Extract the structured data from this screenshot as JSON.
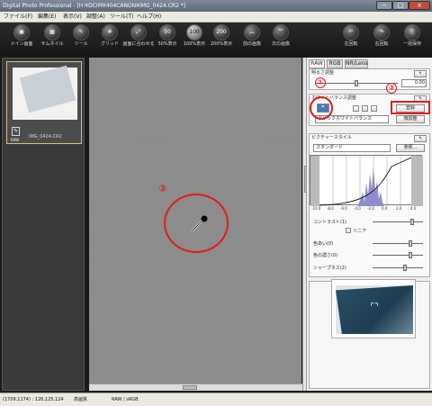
{
  "app": {
    "title": "Digital Photo Professional - [H:¥DCIM¥404CANON¥IMG_0424.CR2 *]"
  },
  "window_buttons": {
    "minimize": "−",
    "maximize": "□",
    "close": "×"
  },
  "menu": [
    "ファイル(F)",
    "編集(E)",
    "表示(V)",
    "調整(A)",
    "ツール(T)",
    "ヘルプ(H)"
  ],
  "toolbar": [
    {
      "label": "メイン画面",
      "icon": "main-window-icon"
    },
    {
      "label": "サムネイル",
      "icon": "thumbnail-icon"
    },
    {
      "label": "ツール",
      "icon": "tool-icon"
    },
    {
      "label": "グリッド",
      "icon": "grid-icon"
    },
    {
      "label": "画面に合わせる",
      "icon": "fit-screen-icon"
    },
    {
      "label": "50%表示",
      "icon": "zoom-50-icon",
      "glyph": "50"
    },
    {
      "label": "100%表示",
      "icon": "zoom-100-icon",
      "glyph": "100"
    },
    {
      "label": "200%表示",
      "icon": "zoom-200-icon",
      "glyph": "200"
    },
    {
      "label": "前の画像",
      "icon": "previous-image-icon"
    },
    {
      "label": "次の画像",
      "icon": "next-image-icon"
    },
    {
      "label": "左回転",
      "icon": "rotate-left-icon"
    },
    {
      "label": "右回転",
      "icon": "rotate-right-icon"
    },
    {
      "label": "一括保存",
      "icon": "batch-save-icon"
    }
  ],
  "thumbnail": {
    "filename": "IMG_0424.CR2",
    "raw_badge": "RAW"
  },
  "tabs": [
    "RAW",
    "RGB",
    "NR/Lens"
  ],
  "panel": {
    "brightness": {
      "title": "明るさ調整",
      "value": "0.00"
    },
    "white_balance": {
      "title": "ホワイトバランス調整",
      "register_button": "登録",
      "preset": "クリックホワイトバランス",
      "fine_tune_button": "微調整"
    },
    "picture_style": {
      "title": "ピクチャースタイル",
      "preset": "スタンダード",
      "browse_button": "参照..."
    },
    "axis_ticks": [
      "-10.0",
      "-8.0",
      "-6.0",
      "-4.0",
      "-2.0",
      "0.0",
      "2.0",
      "4.0"
    ],
    "contrast": {
      "label": "コントラスト(1)"
    },
    "linear": {
      "label": "リニア"
    },
    "tone": {
      "label": "色あい(0)"
    },
    "saturation": {
      "label": "色の濃さ(0)"
    },
    "sharpness": {
      "label": "シャープネス(2)"
    }
  },
  "annotations": [
    "①",
    "②",
    "③"
  ],
  "status": {
    "coords": "(1709,1174) : 126,125,124",
    "quality": "高画質",
    "colorspace": "RAW / sRGB"
  },
  "colors": {
    "annotation": "#e01b1b",
    "canvas": "#8a8a8a"
  }
}
